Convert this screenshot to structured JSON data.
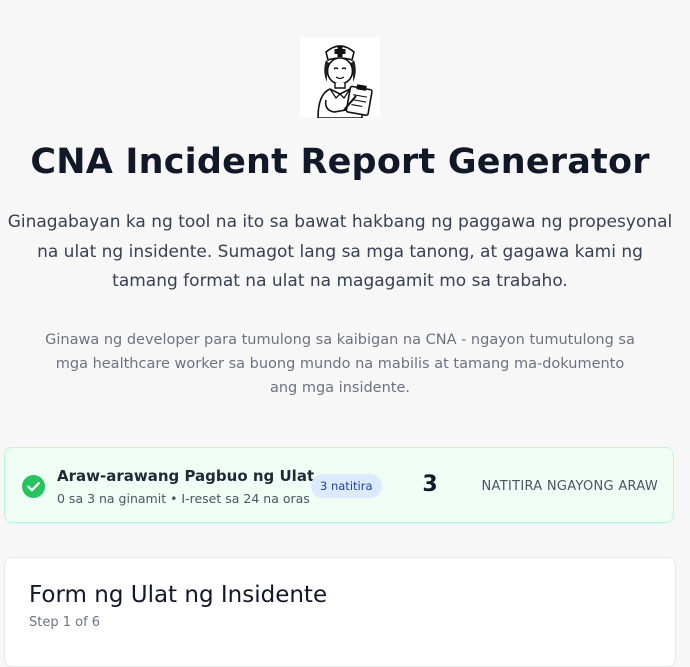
{
  "header": {
    "logo_icon": "nurse-with-clipboard-icon",
    "title": "CNA Incident Report Generator",
    "lead": "Ginagabayan ka ng tool na ito sa bawat hakbang ng paggawa ng propesyonal na ulat ng insidente. Sumagot lang sa mga tanong, at gagawa kami ng tamang format na ulat na magagamit mo sa trabaho.",
    "credit": "Ginawa ng developer para tumulong sa kaibigan na CNA - ngayon tumutulong sa mga healthcare worker sa buong mundo na mabilis at tamang ma-dokumento ang mga insidente."
  },
  "usage": {
    "icon": "check-circle-icon",
    "title": "Araw-arawang Pagbuo ng Ulat",
    "subtitle": "0 sa 3 na ginamit • I-reset sa 24 na oras",
    "badge": "3 natitira",
    "remaining_count": "3",
    "remaining_label": "NATITIRA NGAYONG ARAW",
    "colors": {
      "card_bg": "#f0fdf4",
      "card_border": "#bbf7d0",
      "check": "#22c55e",
      "badge_bg": "#dbeafe",
      "badge_text": "#1e40af"
    }
  },
  "form": {
    "title": "Form ng Ulat ng Insidente",
    "step": "Step 1 of 6"
  }
}
